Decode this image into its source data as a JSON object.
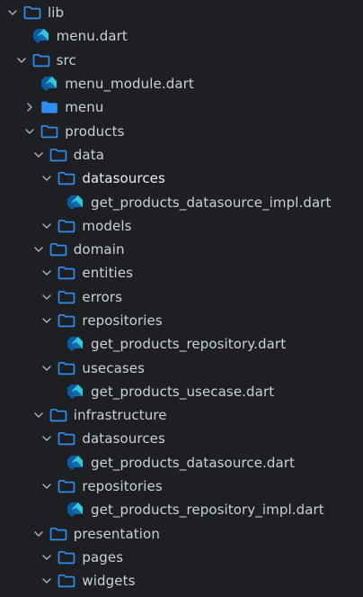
{
  "theme": {
    "background": "#1e1f22",
    "text": "#c9d1d9",
    "chevron": "#aeb4bc",
    "folder_stroke": "#2f8cf0",
    "folder_fill": "#2f8cf0",
    "dart_dark": "#0b5aa3",
    "dart_light": "#35c7d8"
  },
  "tree": [
    {
      "label": "lib",
      "type": "folder",
      "level": 0,
      "expanded": true
    },
    {
      "label": "menu.dart",
      "type": "dart",
      "level": 1
    },
    {
      "label": "src",
      "type": "folder",
      "level": 1,
      "expanded": true
    },
    {
      "label": "menu_module.dart",
      "type": "dart",
      "level": 2
    },
    {
      "label": "menu",
      "type": "folder",
      "level": 2,
      "expanded": false,
      "filled": true
    },
    {
      "label": "products",
      "type": "folder",
      "level": 2,
      "expanded": true
    },
    {
      "label": "data",
      "type": "folder",
      "level": 3,
      "expanded": true
    },
    {
      "label": "datasources",
      "type": "folder",
      "level": 4,
      "expanded": true
    },
    {
      "label": "get_products_datasource_impl.dart",
      "type": "dart",
      "level": 5
    },
    {
      "label": "models",
      "type": "folder",
      "level": 4,
      "expanded": true
    },
    {
      "label": "domain",
      "type": "folder",
      "level": 3,
      "expanded": true
    },
    {
      "label": "entities",
      "type": "folder",
      "level": 4,
      "expanded": true
    },
    {
      "label": "errors",
      "type": "folder",
      "level": 4,
      "expanded": true
    },
    {
      "label": "repositories",
      "type": "folder",
      "level": 4,
      "expanded": true
    },
    {
      "label": "get_products_repository.dart",
      "type": "dart",
      "level": 5
    },
    {
      "label": "usecases",
      "type": "folder",
      "level": 4,
      "expanded": true
    },
    {
      "label": "get_products_usecase.dart",
      "type": "dart",
      "level": 5
    },
    {
      "label": "infrastructure",
      "type": "folder",
      "level": 3,
      "expanded": true
    },
    {
      "label": "datasources",
      "type": "folder",
      "level": 4,
      "expanded": true
    },
    {
      "label": "get_products_datasource.dart",
      "type": "dart",
      "level": 5
    },
    {
      "label": "repositories",
      "type": "folder",
      "level": 4,
      "expanded": true
    },
    {
      "label": "get_products_repository_impl.dart",
      "type": "dart",
      "level": 5
    },
    {
      "label": "presentation",
      "type": "folder",
      "level": 3,
      "expanded": true
    },
    {
      "label": "pages",
      "type": "folder",
      "level": 4,
      "expanded": true
    },
    {
      "label": "widgets",
      "type": "folder",
      "level": 4,
      "expanded": true
    }
  ]
}
